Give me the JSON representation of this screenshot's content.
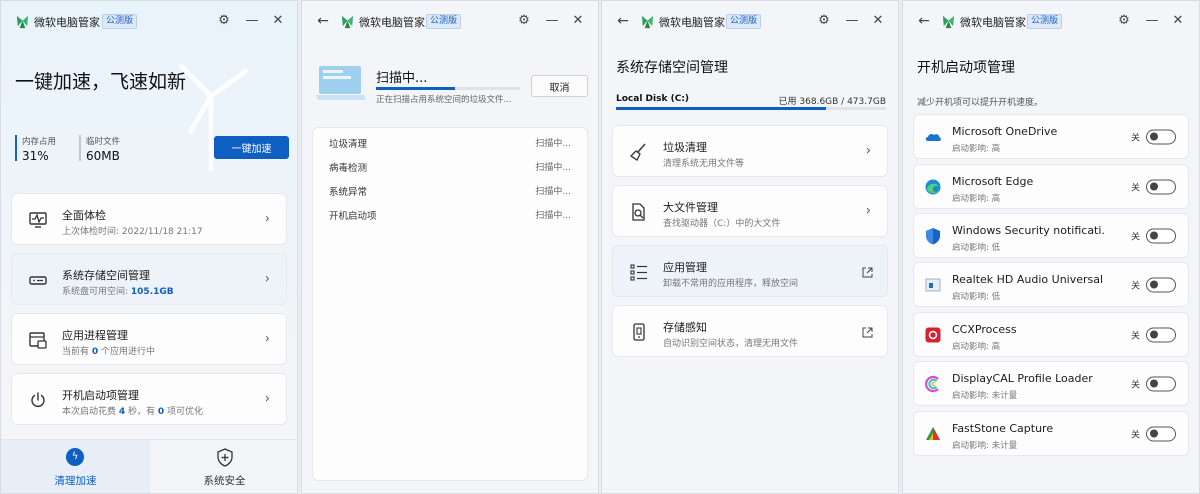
{
  "app": {
    "title": "微软电脑管家",
    "badge": "公测版"
  },
  "colors": {
    "accent": "#0f5fc2",
    "logo_green": "#2e9e5b"
  },
  "panel1": {
    "hero_title": "一键加速，飞速如新",
    "stats": [
      {
        "label": "内存占用",
        "value": "31%"
      },
      {
        "label": "临时文件",
        "value": "60MB"
      }
    ],
    "boost_button": "一键加速",
    "cards": [
      {
        "icon": "health-check-icon",
        "title": "全面体检",
        "sub": "上次体检时间: 2022/11/18 21:17"
      },
      {
        "icon": "storage-icon",
        "title": "系统存储空间管理",
        "sub_prefix": "系统盘可用空间: ",
        "sub_value": "105.1GB"
      },
      {
        "icon": "process-icon",
        "title": "应用进程管理",
        "sub_prefix": "当前有 ",
        "sub_value": "0",
        "sub_suffix": " 个应用进行中"
      },
      {
        "icon": "power-icon",
        "title": "开机启动项管理",
        "sub_prefix": "本次启动花费 ",
        "sub_value": "4",
        "sub_mid": " 秒，有 ",
        "sub_value2": "0",
        "sub_suffix": " 项可优化"
      }
    ],
    "nav": [
      {
        "label": "清理加速",
        "icon": "lightning-icon",
        "active": true
      },
      {
        "label": "系统安全",
        "icon": "shield-icon",
        "active": false
      }
    ]
  },
  "panel2": {
    "scan_title": "扫描中...",
    "scan_sub": "正在扫描占用系统空间的垃圾文件...",
    "progress": 0.55,
    "cancel_button": "取消",
    "rows": [
      {
        "name": "垃圾清理",
        "status": "扫描中..."
      },
      {
        "name": "病毒检测",
        "status": "扫描中..."
      },
      {
        "name": "系统异常",
        "status": "扫描中..."
      },
      {
        "name": "开机启动项",
        "status": "扫描中..."
      }
    ]
  },
  "panel3": {
    "title": "系统存储空间管理",
    "disk_name": "Local Disk (C:)",
    "disk_used": "已用 368.6GB / 473.7GB",
    "disk_fill": 0.778,
    "cards": [
      {
        "icon": "broom-icon",
        "title": "垃圾清理",
        "sub": "清理系统无用文件等",
        "action": "chevron"
      },
      {
        "icon": "large-file-icon",
        "title": "大文件管理",
        "sub": "查找驱动器（C:）中的大文件",
        "action": "chevron"
      },
      {
        "icon": "app-list-icon",
        "title": "应用管理",
        "sub": "卸载不常用的应用程序，释放空间",
        "action": "external"
      },
      {
        "icon": "storage-sense-icon",
        "title": "存储感知",
        "sub": "自动识别空间状态，清理无用文件",
        "action": "external"
      }
    ]
  },
  "panel4": {
    "title": "开机启动项管理",
    "subtitle": "减少开机项可以提升开机速度。",
    "toggle_label": "关",
    "items": [
      {
        "icon": "onedrive-icon",
        "name": "Microsoft OneDrive",
        "impact": "启动影响: 高"
      },
      {
        "icon": "edge-icon",
        "name": "Microsoft Edge",
        "impact": "启动影响: 高"
      },
      {
        "icon": "windows-security-icon",
        "name": "Windows Security notificati...",
        "impact": "启动影响: 低"
      },
      {
        "icon": "realtek-audio-icon",
        "name": "Realtek HD Audio Universal ...",
        "impact": "启动影响: 低"
      },
      {
        "icon": "ccxprocess-icon",
        "name": "CCXProcess",
        "impact": "启动影响: 高"
      },
      {
        "icon": "displaycal-icon",
        "name": "DisplayCAL Profile Loader",
        "impact": "启动影响: 未计量"
      },
      {
        "icon": "faststone-icon",
        "name": "FastStone Capture",
        "impact": "启动影响: 未计量"
      }
    ]
  }
}
